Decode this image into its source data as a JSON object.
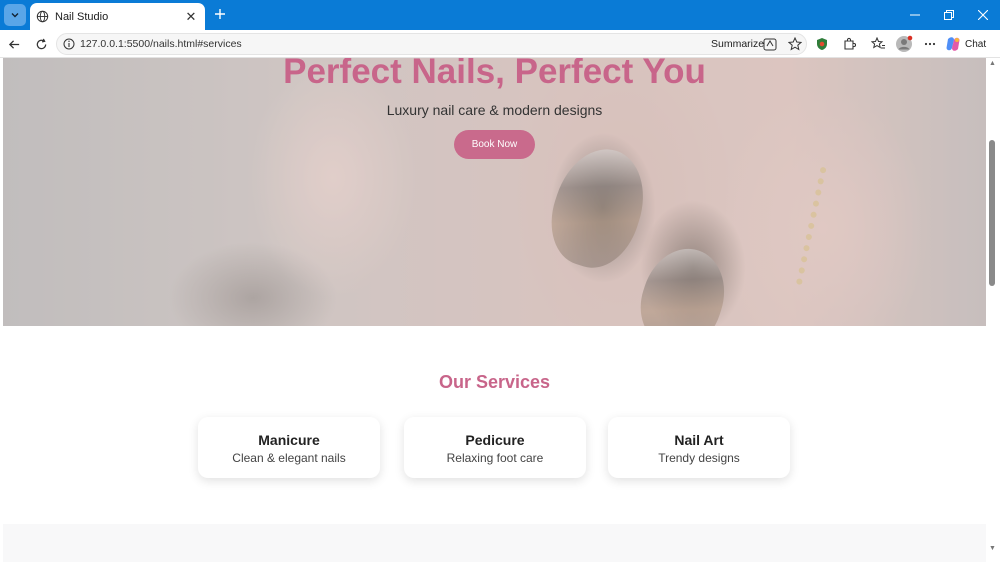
{
  "browser": {
    "tab": {
      "title": "Nail Studio"
    },
    "address": {
      "url": "127.0.0.1:5500/nails.html#services"
    },
    "toolbar": {
      "summarize_label": "Summarize",
      "chat_label": "Chat"
    }
  },
  "hero": {
    "title": "Perfect Nails, Perfect You",
    "subtitle": "Luxury nail care & modern designs",
    "cta_label": "Book Now"
  },
  "services": {
    "title": "Our Services",
    "items": [
      {
        "name": "Manicure",
        "description": "Clean & elegant nails"
      },
      {
        "name": "Pedicure",
        "description": "Relaxing foot care"
      },
      {
        "name": "Nail Art",
        "description": "Trendy designs"
      }
    ]
  },
  "colors": {
    "browser_frame": "#0a7bd6",
    "accent_pink": "#c8658a",
    "button_pink": "#c96a8c"
  }
}
